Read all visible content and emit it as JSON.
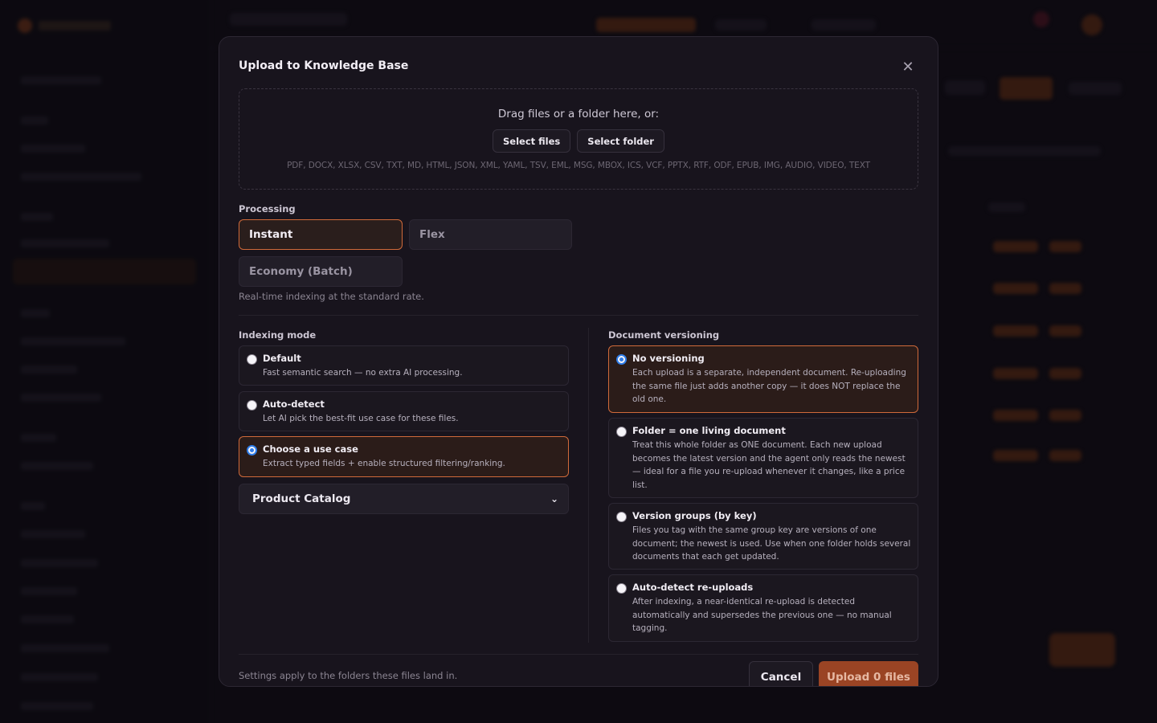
{
  "modal": {
    "title": "Upload to Knowledge Base",
    "close_icon": "close-icon"
  },
  "dropzone": {
    "title": "Drag files or a folder here, or:",
    "select_files": "Select files",
    "select_folder": "Select folder",
    "formats": "PDF, DOCX, XLSX, CSV, TXT, MD, HTML, JSON, XML, YAML, TSV, EML, MSG, MBOX, ICS, VCF, PPTX, RTF, ODF, EPUB, IMG, AUDIO, VIDEO, TEXT"
  },
  "processing": {
    "label": "Processing",
    "options": [
      "Instant",
      "Flex",
      "Economy (Batch)"
    ],
    "selected": "Instant",
    "note": "Real-time indexing at the standard rate."
  },
  "indexing": {
    "label": "Indexing mode",
    "options": [
      {
        "title": "Default",
        "desc": "Fast semantic search — no extra AI processing.",
        "selected": false
      },
      {
        "title": "Auto-detect",
        "desc": "Let AI pick the best-fit use case for these files.",
        "selected": false
      },
      {
        "title": "Choose a use case",
        "desc": "Extract typed fields + enable structured filtering/ranking.",
        "selected": true
      }
    ],
    "use_case_value": "Product Catalog"
  },
  "versioning": {
    "label": "Document versioning",
    "options": [
      {
        "title": "No versioning",
        "desc": "Each upload is a separate, independent document. Re-uploading the same file just adds another copy — it does NOT replace the old one.",
        "selected": true
      },
      {
        "title": "Folder = one living document",
        "desc": "Treat this whole folder as ONE document. Each new upload becomes the latest version and the agent only reads the newest — ideal for a file you re-upload whenever it changes, like a price list.",
        "selected": false
      },
      {
        "title": "Version groups (by key)",
        "desc": "Files you tag with the same group key are versions of one document; the newest is used. Use when one folder holds several documents that each get updated.",
        "selected": false
      },
      {
        "title": "Auto-detect re-uploads",
        "desc": "After indexing, a near-identical re-upload is detected automatically and supersedes the previous one — no manual tagging.",
        "selected": false
      }
    ]
  },
  "footer": {
    "note": "Settings apply to the folders these files land in.",
    "cancel": "Cancel",
    "upload": "Upload 0 files"
  },
  "colors": {
    "accent": "#d06a3a",
    "radio": "#2f7dea",
    "upload_button": "#9a4424"
  }
}
